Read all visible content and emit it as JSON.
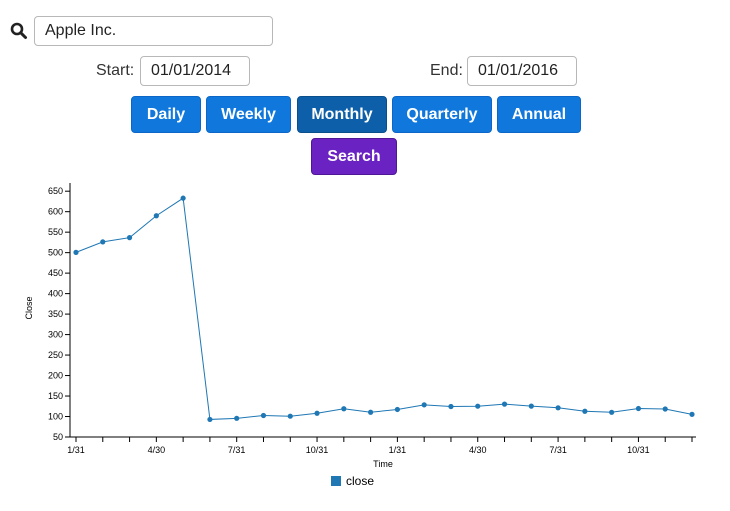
{
  "search": {
    "value": "Apple Inc.",
    "icon": "search-icon"
  },
  "dates": {
    "start_label": "Start:",
    "start_value": "01/01/2014",
    "end_label": "End:",
    "end_value": "01/01/2016"
  },
  "intervals": [
    "Daily",
    "Weekly",
    "Monthly",
    "Quarterly",
    "Annual"
  ],
  "active_interval": "Monthly",
  "search_button": "Search",
  "colors": {
    "primary": "#1078dc",
    "active": "#0c5fa8",
    "search": "#6a22c2",
    "series": "#1f77b4"
  },
  "chart_data": {
    "type": "line",
    "title": "",
    "xlabel": "Time",
    "ylabel": "Close",
    "ylim": [
      50,
      670
    ],
    "yticks": [
      50,
      100,
      150,
      200,
      250,
      300,
      350,
      400,
      450,
      500,
      550,
      600,
      650
    ],
    "xticks": [
      "1/31",
      "4/30",
      "7/31",
      "10/31",
      "1/31",
      "4/30",
      "7/31",
      "10/31"
    ],
    "legend": {
      "position": "bottom-center",
      "entries": [
        "close"
      ]
    },
    "series": [
      {
        "name": "close",
        "x": [
          "2014-01-31",
          "2014-02-28",
          "2014-03-31",
          "2014-04-30",
          "2014-05-30",
          "2014-06-30",
          "2014-07-31",
          "2014-08-29",
          "2014-09-30",
          "2014-10-31",
          "2014-11-28",
          "2014-12-31",
          "2015-01-30",
          "2015-02-27",
          "2015-03-31",
          "2015-04-30",
          "2015-05-29",
          "2015-06-30",
          "2015-07-31",
          "2015-08-31",
          "2015-09-30",
          "2015-10-30",
          "2015-11-30",
          "2015-12-31"
        ],
        "values": [
          500.6,
          526.2,
          536.7,
          590.1,
          633.0,
          92.9,
          95.6,
          102.5,
          100.8,
          108.0,
          118.9,
          110.4,
          117.2,
          128.5,
          124.4,
          125.2,
          130.3,
          125.4,
          121.3,
          112.8,
          110.3,
          119.5,
          118.3,
          105.3
        ]
      }
    ]
  }
}
